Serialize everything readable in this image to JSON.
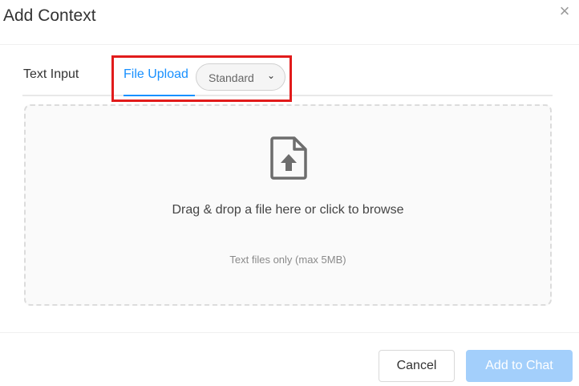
{
  "dialog": {
    "title": "Add Context",
    "close_icon": "close-icon",
    "close_glyph": "×"
  },
  "tabs": [
    {
      "label": "Text Input",
      "active": false
    },
    {
      "label": "File Upload",
      "active": true
    }
  ],
  "mode_select": {
    "selected": "Standard",
    "chevron_icon": "chevron-down-icon",
    "chevron_glyph": "⌄"
  },
  "dropzone": {
    "icon": "file-upload-icon",
    "main_text": "Drag & drop a file here or click to browse",
    "sub_text": "Text files only (max 5MB)"
  },
  "footer": {
    "cancel_label": "Cancel",
    "add_label": "Add to Chat",
    "add_disabled": true
  },
  "colors": {
    "accent": "#1890ff",
    "highlight": "#e11b1b",
    "add_button_disabled": "#a3cffb"
  }
}
